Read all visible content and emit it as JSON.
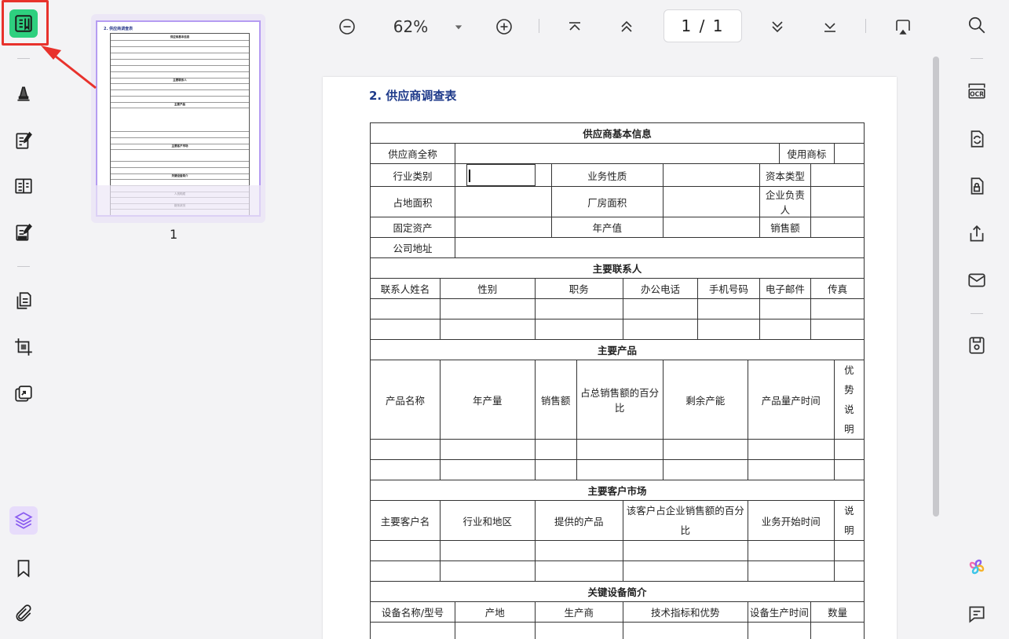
{
  "toolbar": {
    "zoom": "62%",
    "page_indicator": "1 / 1"
  },
  "thumbnails": {
    "page_number": "1",
    "mini_title": "2. 供应商调查表",
    "mini_sections": [
      "供应商基本信息",
      "主要联系人",
      "主要产品",
      "主要客户市场",
      "关键设备简介",
      "人员构成",
      "财务状况"
    ]
  },
  "document": {
    "title": "2. 供应商调查表",
    "basic_info": {
      "header": "供应商基本信息",
      "full_name": "供应商全称",
      "brand": "使用商标",
      "industry": "行业类别",
      "business_nature": "业务性质",
      "capital_type": "资本类型",
      "land_area": "占地面积",
      "plant_area": "厂房面积",
      "legal_person": "企业负责人",
      "fixed_assets": "固定资产",
      "annual_output": "年产值",
      "sales": "销售额",
      "address": "公司地址"
    },
    "contacts": {
      "header": "主要联系人",
      "columns": [
        "联系人姓名",
        "性别",
        "职务",
        "办公电话",
        "手机号码",
        "电子邮件",
        "传真"
      ]
    },
    "products": {
      "header": "主要产品",
      "columns": [
        "产品名称",
        "年产量",
        "销售额",
        "占总销售额的百分比",
        "剩余产能",
        "产品量产时间",
        "优势说明"
      ]
    },
    "customers": {
      "header": "主要客户市场",
      "columns": [
        "主要客户名",
        "行业和地区",
        "提供的产品",
        "该客户占企业销售额的百分比",
        "业务开始时间",
        "说明"
      ]
    },
    "equipment": {
      "header": "关键设备简介",
      "columns": [
        "设备名称/型号",
        "产地",
        "生产商",
        "技术指标和优势",
        "设备生产时间",
        "数量"
      ]
    }
  },
  "colors": {
    "active_tool": "#2ed07f",
    "highlight": "#e8322c",
    "title_blue": "#1e3a8a",
    "thumb_border": "#b59cf2"
  }
}
